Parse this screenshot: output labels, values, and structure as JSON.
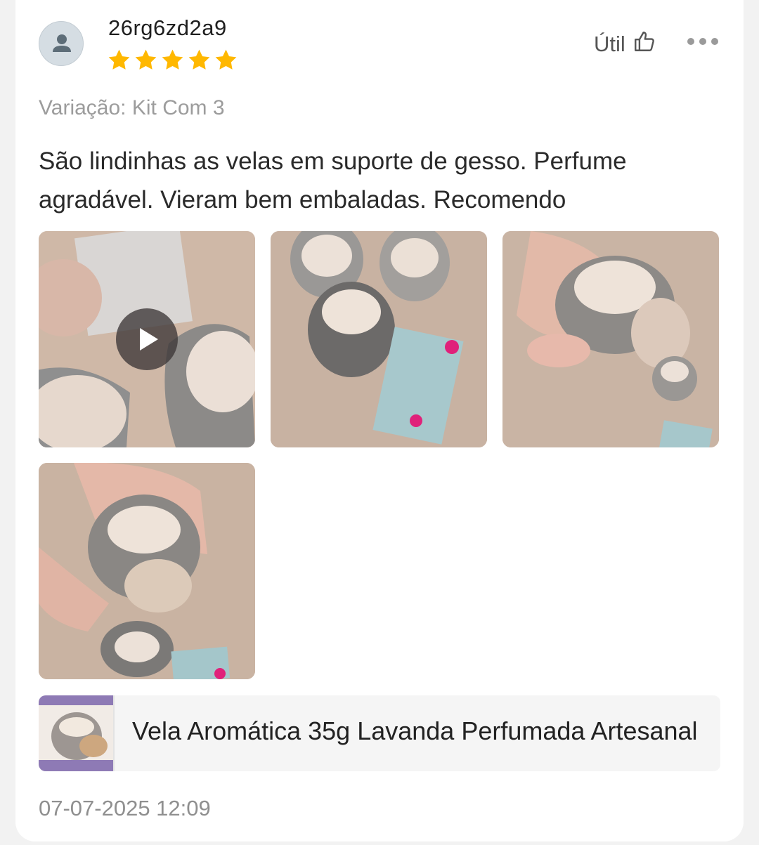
{
  "review": {
    "username": "26rg6zd2a9",
    "rating": 5,
    "rating_max": 5,
    "helpful_label": "Útil",
    "variation": "Variação: Kit Com 3",
    "text": "São lindinhas as velas em suporte de gesso. Perfume agradável. Vieram bem embaladas. Recomendo",
    "date": "07-07-2025 12:09"
  },
  "media": [
    {
      "type": "video",
      "icon": "play-icon"
    },
    {
      "type": "image"
    },
    {
      "type": "image"
    },
    {
      "type": "image"
    }
  ],
  "product": {
    "name": "Vela Aromática 35g Lavanda Perfumada Artesanal"
  },
  "icons": {
    "avatar": "user-icon",
    "helpful": "thumbs-up-icon",
    "more": "more-horizontal-icon",
    "star": "star-icon"
  },
  "colors": {
    "star": "#ffb800",
    "text_primary": "#2a2a2a",
    "text_secondary": "#9c9c9c"
  }
}
